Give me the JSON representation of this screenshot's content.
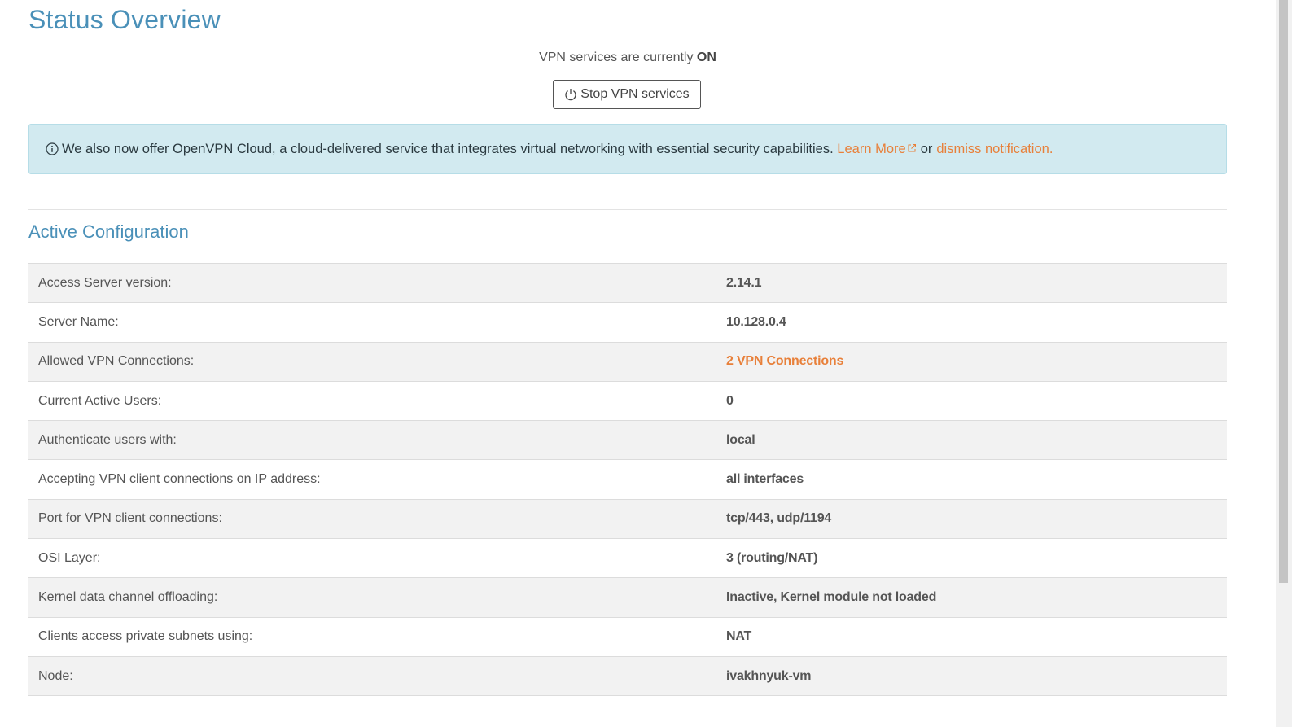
{
  "header": {
    "title": "Status Overview"
  },
  "status": {
    "prefix": "VPN services are currently",
    "state": "ON",
    "stop_button_label": "Stop VPN services"
  },
  "notification": {
    "message": "We also now offer OpenVPN Cloud, a cloud-delivered service that integrates virtual networking with essential security capabilities.",
    "learn_more": "Learn More",
    "or_text": "or",
    "dismiss": "dismiss notification."
  },
  "active_configuration": {
    "title": "Active Configuration",
    "rows": [
      {
        "label": "Access Server version:",
        "value": "2.14.1"
      },
      {
        "label": "Server Name:",
        "value": "10.128.0.4"
      },
      {
        "label": "Allowed VPN Connections:",
        "value": "2 VPN Connections"
      },
      {
        "label": "Current Active Users:",
        "value": "0"
      },
      {
        "label": "Authenticate users with:",
        "value": "local"
      },
      {
        "label": "Accepting VPN client connections on IP address:",
        "value": "all interfaces"
      },
      {
        "label": "Port for VPN client connections:",
        "value": "tcp/443, udp/1194"
      },
      {
        "label": "OSI Layer:",
        "value": "3 (routing/NAT)"
      },
      {
        "label": "Kernel data channel offloading:",
        "value": "Inactive, Kernel module not loaded"
      },
      {
        "label": "Clients access private subnets using:",
        "value": "NAT"
      },
      {
        "label": "Node:",
        "value": "ivakhnyuk-vm"
      }
    ]
  },
  "colors": {
    "title_blue": "#4a90b8",
    "link_orange": "#e8803a",
    "alert_bg": "#d2eaf0"
  }
}
